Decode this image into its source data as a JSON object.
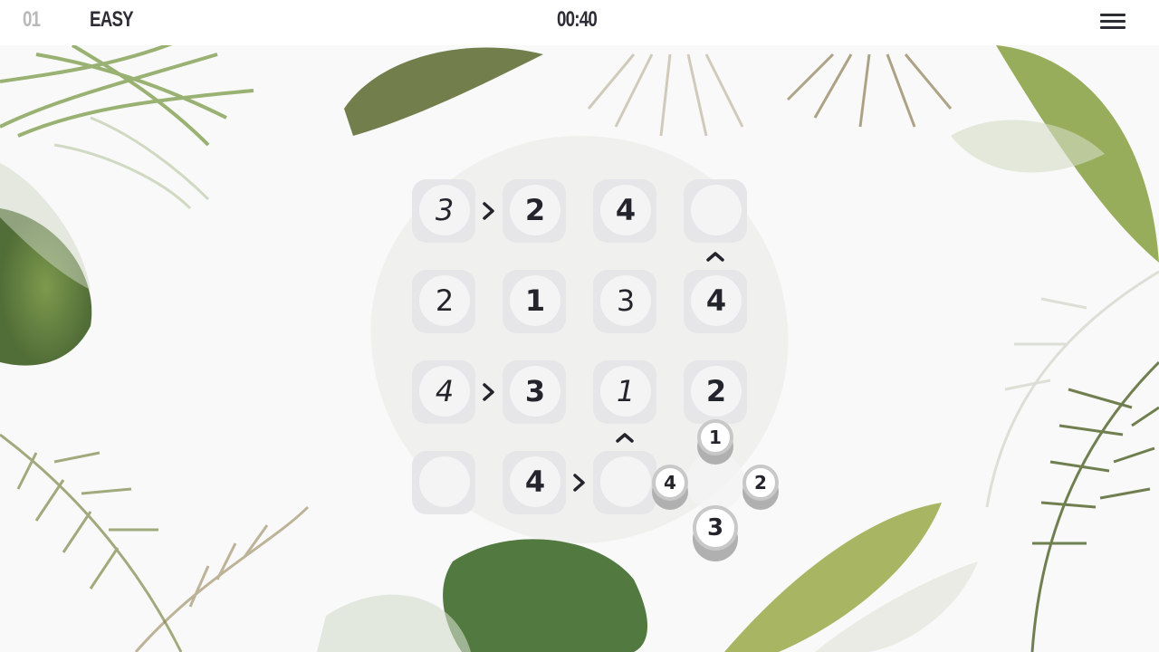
{
  "header": {
    "level": "01",
    "difficulty": "EASY",
    "timer": "00:40",
    "menu_icon": "hamburger-menu-icon"
  },
  "grid": {
    "size": 4,
    "cells": [
      [
        {
          "value": "3",
          "kind": "user"
        },
        {
          "value": "2",
          "kind": "given"
        },
        {
          "value": "4",
          "kind": "given"
        },
        {
          "value": "",
          "kind": "empty"
        }
      ],
      [
        {
          "value": "2",
          "kind": "user"
        },
        {
          "value": "1",
          "kind": "given"
        },
        {
          "value": "3",
          "kind": "user"
        },
        {
          "value": "4",
          "kind": "given"
        }
      ],
      [
        {
          "value": "4",
          "kind": "user"
        },
        {
          "value": "3",
          "kind": "given"
        },
        {
          "value": "1",
          "kind": "user"
        },
        {
          "value": "2",
          "kind": "given"
        }
      ],
      [
        {
          "value": "",
          "kind": "empty"
        },
        {
          "value": "4",
          "kind": "given"
        },
        {
          "value": "",
          "kind": "empty"
        },
        {
          "value": "",
          "kind": "selected"
        }
      ]
    ],
    "constraints": [
      {
        "between": "r1c1-r1c2",
        "symbol": ">",
        "icon": "greater-than-icon"
      },
      {
        "between": "r1c4-r2c4",
        "symbol": "^",
        "icon": "less-than-up-icon"
      },
      {
        "between": "r3c1-r3c2",
        "symbol": ">",
        "icon": "greater-than-icon"
      },
      {
        "between": "r3c3-r4c3",
        "symbol": "^",
        "icon": "less-than-up-icon"
      },
      {
        "between": "r4c2-r4c3",
        "symbol": ">",
        "icon": "greater-than-icon"
      }
    ]
  },
  "picker": {
    "options": [
      "1",
      "2",
      "3",
      "4"
    ]
  },
  "colors": {
    "text": "#24242c",
    "level_muted": "#b9b9b9",
    "cell_bg": "#e6e6e8",
    "cell_inner": "#f4f4f5",
    "background": "#f9f9f9"
  }
}
